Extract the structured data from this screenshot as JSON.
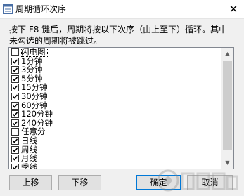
{
  "window": {
    "title": "周期循环次序",
    "close_glyph": "✕"
  },
  "description": "按下 F8 键后，周期将按以下次序（由上至下）循环。其中\n未勾选的周期将被跳过。",
  "list": {
    "items": [
      {
        "label": "闪电图",
        "checked": false,
        "focused": true
      },
      {
        "label": "1分钟",
        "checked": true
      },
      {
        "label": "3分钟",
        "checked": true
      },
      {
        "label": "5分钟",
        "checked": true
      },
      {
        "label": "15分钟",
        "checked": true
      },
      {
        "label": "30分钟",
        "checked": true
      },
      {
        "label": "60分钟",
        "checked": true
      },
      {
        "label": "120分钟",
        "checked": true
      },
      {
        "label": "240分钟",
        "checked": true
      },
      {
        "label": "任意分",
        "checked": false
      },
      {
        "label": "日线",
        "checked": true
      },
      {
        "label": "周线",
        "checked": true
      },
      {
        "label": "月线",
        "checked": true
      },
      {
        "label": "季线",
        "checked": true
      }
    ]
  },
  "buttons": {
    "move_up": "上移",
    "move_down": "下移",
    "ok": "确定",
    "cancel": "取消"
  },
  "colors": {
    "accent": "#0078d7"
  }
}
